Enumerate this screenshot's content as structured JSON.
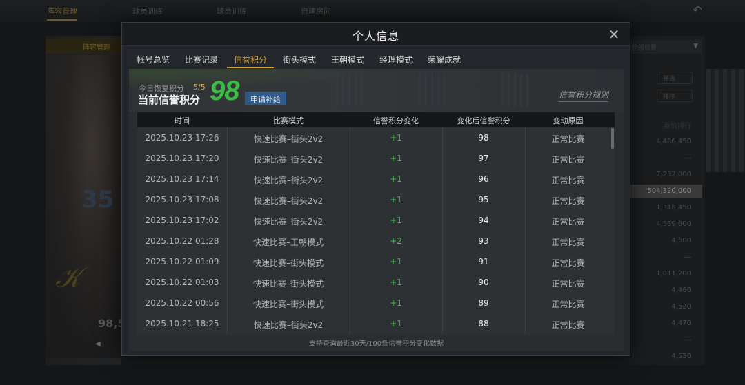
{
  "background": {
    "nav": [
      "阵容管理",
      "球员训练",
      "球员训练",
      "自建房间"
    ],
    "left_tab": "阵容管理",
    "card_number": "35",
    "card_value": "98,5",
    "right_select": "全部位置",
    "right_buttons": [
      "筛选",
      "排序"
    ],
    "right_header": "身价排行",
    "right_values": [
      "4,486,450",
      "—",
      "7,232,000",
      "504,320,000",
      "1,318,450",
      "4,569,600",
      "4,500",
      "—",
      "1,011,200",
      "4,460",
      "4,520",
      "4,470",
      "—",
      "4,550"
    ]
  },
  "modal": {
    "title": "个人信息",
    "tabs": [
      "帐号总览",
      "比赛记录",
      "信誉积分",
      "街头模式",
      "王朝模式",
      "经理模式",
      "荣耀成就"
    ],
    "active_tab": "信誉积分"
  },
  "banner": {
    "recover_label": "今日恢复积分",
    "recover_count": "5/5",
    "current_label": "当前信誉积分",
    "score": "98",
    "apply_button": "申请补给",
    "rules_link": "信誉积分规则"
  },
  "table": {
    "headers": [
      "时间",
      "比赛模式",
      "信誉积分变化",
      "变化后信誉积分",
      "变动原因"
    ],
    "rows": [
      {
        "time": "2025.10.23  17:26",
        "mode": "快速比赛–街头2v2",
        "change": "+1",
        "after": "98",
        "reason": "正常比赛"
      },
      {
        "time": "2025.10.23  17:20",
        "mode": "快速比赛–街头2v2",
        "change": "+1",
        "after": "97",
        "reason": "正常比赛"
      },
      {
        "time": "2025.10.23  17:14",
        "mode": "快速比赛–街头2v2",
        "change": "+1",
        "after": "96",
        "reason": "正常比赛"
      },
      {
        "time": "2025.10.23  17:08",
        "mode": "快速比赛–街头2v2",
        "change": "+1",
        "after": "95",
        "reason": "正常比赛"
      },
      {
        "time": "2025.10.23  17:02",
        "mode": "快速比赛–街头2v2",
        "change": "+1",
        "after": "94",
        "reason": "正常比赛"
      },
      {
        "time": "2025.10.22  01:28",
        "mode": "快速比赛–王朝模式",
        "change": "+2",
        "after": "93",
        "reason": "正常比赛"
      },
      {
        "time": "2025.10.22  01:09",
        "mode": "快速比赛–街头模式",
        "change": "+1",
        "after": "91",
        "reason": "正常比赛"
      },
      {
        "time": "2025.10.22  01:03",
        "mode": "快速比赛–街头模式",
        "change": "+1",
        "after": "90",
        "reason": "正常比赛"
      },
      {
        "time": "2025.10.22  00:56",
        "mode": "快速比赛–街头模式",
        "change": "+1",
        "after": "89",
        "reason": "正常比赛"
      },
      {
        "time": "2025.10.21  18:25",
        "mode": "快速比赛–街头2v2",
        "change": "+1",
        "after": "88",
        "reason": "正常比赛"
      }
    ],
    "footer_note": "支持查询最近30天/100条信誉积分变化数据"
  },
  "colors": {
    "accent": "#d9a43a",
    "score": "#3dbb45",
    "positive": "#3fbf4a",
    "button": "#2f5a8a"
  }
}
